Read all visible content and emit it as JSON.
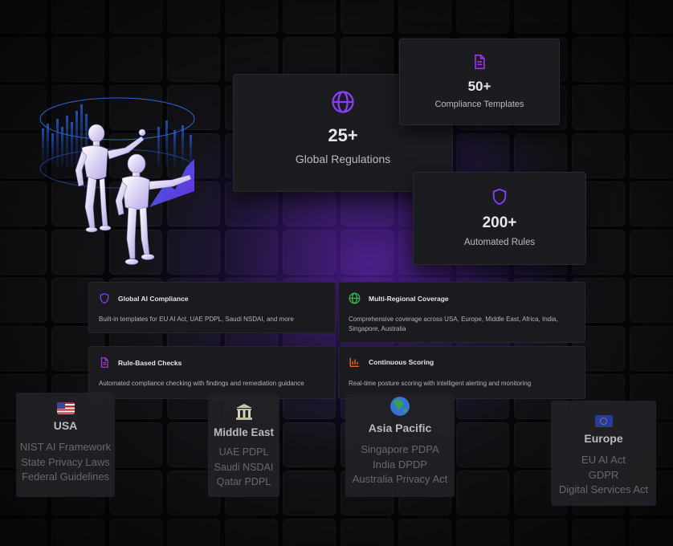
{
  "stats": {
    "regulations": {
      "value": "25+",
      "label": "Global Regulations",
      "icon": "globe-icon"
    },
    "templates": {
      "value": "50+",
      "label": "Compliance Templates",
      "icon": "document-icon"
    },
    "rules": {
      "value": "200+",
      "label": "Automated Rules",
      "icon": "shield-icon"
    }
  },
  "features": [
    {
      "title": "Global AI Compliance",
      "description": "Built-in templates for EU AI Act, UAE PDPL, Saudi NSDAI, and more",
      "icon": "shield-icon",
      "icon_color": "#8b3dff"
    },
    {
      "title": "Multi-Regional Coverage",
      "description": "Comprehensive coverage across USA, Europe, Middle East, Africa, India, Singapore, Australia",
      "icon": "globe-icon",
      "icon_color": "#2fbf4a"
    },
    {
      "title": "Rule-Based Checks",
      "description": "Automated compliance checking with findings and remediation guidance",
      "icon": "document-icon",
      "icon_color": "#9b35e6"
    },
    {
      "title": "Continuous Scoring",
      "description": "Real-time posture scoring with intelligent alerting and monitoring",
      "icon": "bar-chart-icon",
      "icon_color": "#e86a1c"
    }
  ],
  "regions": [
    {
      "name": "USA",
      "flag": "🇺🇸",
      "icon": "us-flag-icon",
      "items": [
        "NIST AI Framework",
        "State Privacy Laws",
        "Federal Guidelines"
      ]
    },
    {
      "name": "Middle East",
      "flag": "🏛",
      "icon": "classical-building-icon",
      "items": [
        "UAE PDPL",
        "Saudi NSDAI",
        "Qatar PDPL"
      ]
    },
    {
      "name": "Asia Pacific",
      "flag": "🌏",
      "icon": "earth-asia-icon",
      "items": [
        "Singapore PDPA",
        "India DPDP",
        "Australia Privacy Act"
      ]
    },
    {
      "name": "Europe",
      "flag": "🇪🇺",
      "icon": "eu-flag-icon",
      "items": [
        "EU AI Act",
        "GDPR",
        "Digital Services Act"
      ]
    }
  ],
  "colors": {
    "accent": "#8b3dff",
    "background": "#07070a",
    "card": "#1c1c20"
  }
}
